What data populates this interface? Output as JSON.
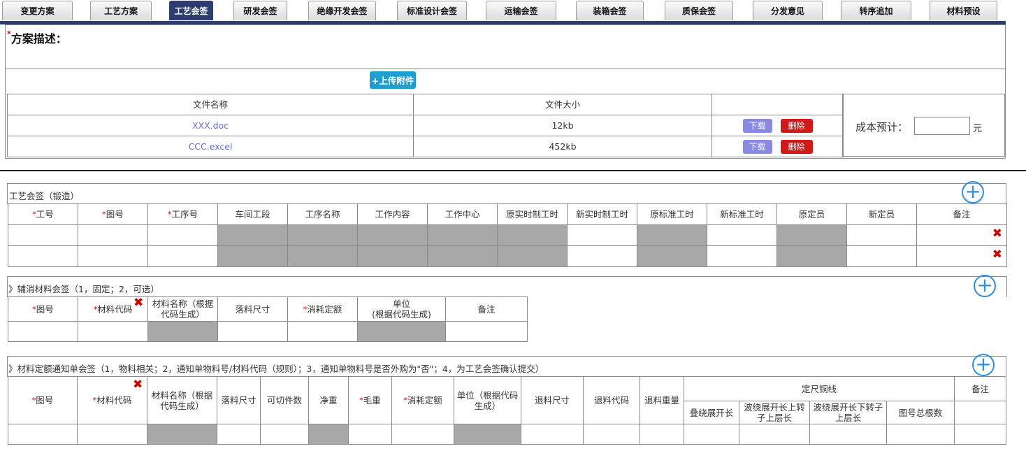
{
  "tabs": [
    "变更方案",
    "工艺方案",
    "工艺会签",
    "研发会签",
    "绝缘开发会签",
    "标准设计会签",
    "运输会签",
    "装箱会签",
    "质保会签",
    "分发意见",
    "转序追加",
    "材料预设"
  ],
  "active_tab_index": 2,
  "desc": {
    "star": "*",
    "label": "方案描述："
  },
  "upload_button": "+上传附件",
  "files": {
    "headers": [
      "文件名称",
      "文件大小",
      ""
    ],
    "rows": [
      {
        "name": "XXX.doc",
        "size": "12kb"
      },
      {
        "name": "CCC.excel",
        "size": "452kb"
      }
    ],
    "download_label": "下载",
    "delete_label": "删除"
  },
  "cost": {
    "label": "成本预计：",
    "unit": "元",
    "value": ""
  },
  "process_sign": {
    "title": "工艺会签（锻造）",
    "headers": [
      "*工号",
      "*图号",
      "*工序号",
      "车间工段",
      "工序名称",
      "工作内容",
      "工作中心",
      "原实时制工时",
      "新实时制工时",
      "原标准工时",
      "新标准工时",
      "原定员",
      "新定员",
      "备注"
    ]
  },
  "aux_sign": {
    "title": "》辅消材料会签（1，固定；2，可选）",
    "headers": [
      "*图号",
      "*材料代码",
      "材料名称（根据代码生成）",
      "落料尺寸",
      "*消耗定额",
      "单位\n(根据代码生成)",
      "备注"
    ]
  },
  "quota_sign": {
    "title": "》材料定额通知单会签（1，物料相关；2，通知单物料号/材料代码（规则）；3，通知单物料号是否外购为\"否\"；4，为工艺会签确认提交）",
    "headers": [
      "*图号",
      "*材料代码",
      "材料名称（根据代码生成）",
      "落料尺寸",
      "可切件数",
      "净重",
      "*毛重",
      "*消耗定额",
      "单位（根据代码生成）",
      "退料尺寸",
      "退料代码",
      "退料重量"
    ],
    "group_header": "定尺铜线",
    "group_sub": [
      "叠绕展开长",
      "波绕展开长上转子上层长",
      "波绕展开长下转子上层长",
      "图号总根数"
    ],
    "remark": "备注"
  },
  "colors": {
    "nav": "#2c3d70",
    "plus": "#2f8ee0",
    "delete": "#d01a1a",
    "download": "#8a89e0",
    "upload": "#1e9fd0"
  }
}
